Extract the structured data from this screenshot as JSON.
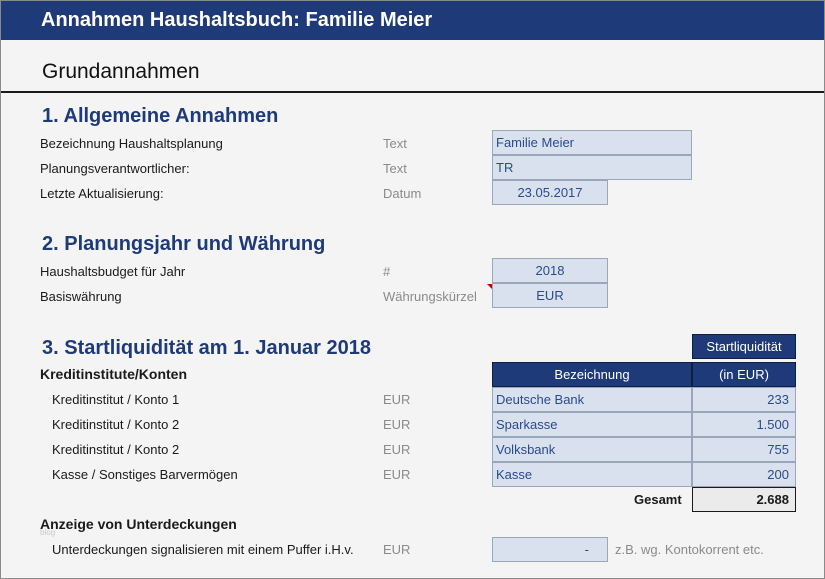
{
  "title": "Annahmen Haushaltsbuch: Familie Meier",
  "subtitle": "Grundannahmen",
  "watermark": "blog",
  "section1": {
    "title": "1. Allgemeine Annahmen",
    "rows": [
      {
        "label": "Bezeichnung Haushaltsplanung",
        "type": "Text",
        "value": "Familie Meier"
      },
      {
        "label": "Planungsverantwortlicher:",
        "type": "Text",
        "value": "TR"
      },
      {
        "label": "Letzte Aktualisierung:",
        "type": "Datum",
        "value": "23.05.2017"
      }
    ]
  },
  "section2": {
    "title": "2. Planungsjahr und Währung",
    "rows": [
      {
        "label": "Haushaltsbudget für Jahr",
        "type": "#",
        "value": "2018"
      },
      {
        "label": "Basiswährung",
        "type": "Währungskürzel",
        "value": "EUR"
      }
    ]
  },
  "section3": {
    "title": "3. Startliquidität am 1. Januar 2018",
    "group_label": "Kreditinstitute/Konten",
    "header_top": "Startliquidität",
    "header_name": "Bezeichnung",
    "header_unit": "(in EUR)",
    "rows": [
      {
        "label": "Kreditinstitut / Konto 1",
        "type": "EUR",
        "name": "Deutsche Bank",
        "amount": "233"
      },
      {
        "label": "Kreditinstitut / Konto 2",
        "type": "EUR",
        "name": "Sparkasse",
        "amount": "1.500"
      },
      {
        "label": "Kreditinstitut / Konto 2",
        "type": "EUR",
        "name": "Volksbank",
        "amount": "755"
      },
      {
        "label": "Kasse / Sonstiges Barvermögen",
        "type": "EUR",
        "name": "Kasse",
        "amount": "200"
      }
    ],
    "total_label": "Gesamt",
    "total_value": "2.688"
  },
  "section4": {
    "title": "Anzeige von Unterdeckungen",
    "label": "Unterdeckungen signalisieren mit einem Puffer i.H.v.",
    "type": "EUR",
    "value": "-",
    "note": "z.B. wg. Kontokorrent etc."
  },
  "colors": {
    "accent": "#1f3a78",
    "input_fill": "#d9e1ee",
    "comment_marker": "#c00000"
  }
}
